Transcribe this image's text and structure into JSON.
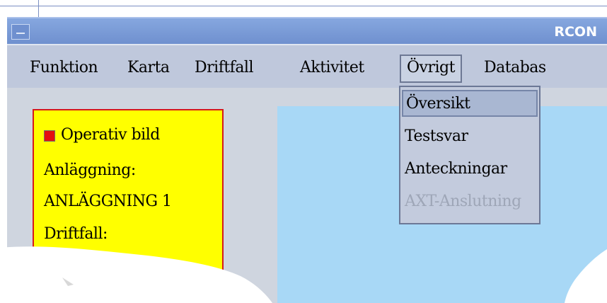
{
  "window": {
    "title": "RCON"
  },
  "menubar": {
    "items": [
      {
        "label": "Funktion"
      },
      {
        "label": "Karta"
      },
      {
        "label": "Driftfall"
      },
      {
        "label": "Aktivitet"
      },
      {
        "label": "Övrigt",
        "active": true
      },
      {
        "label": "Databas"
      }
    ]
  },
  "dropdown": {
    "items": [
      {
        "label": "Översikt",
        "highlighted": true
      },
      {
        "label": "Testsvar"
      },
      {
        "label": "Anteckningar"
      },
      {
        "label": "AXT-Anslutning",
        "disabled": true
      }
    ]
  },
  "panel": {
    "checkbox_label": "Operativ bild",
    "facility_label": "Anläggning:",
    "facility_value": "ANLÄGGNING 1",
    "case_label": "Driftfall:"
  },
  "colors": {
    "titlebar": "#7596d4",
    "menubar": "#bfc8dc",
    "panel_bg": "#ffff00",
    "panel_border": "#d61a1a",
    "map_bg": "#a8d8f6",
    "checkbox": "#e40f0f"
  }
}
